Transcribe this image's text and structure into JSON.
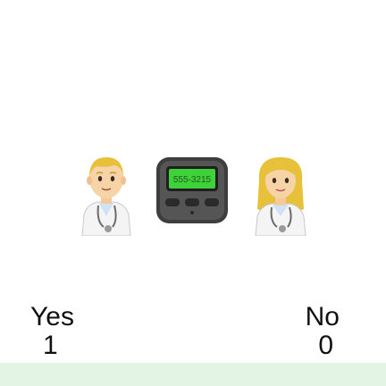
{
  "emojis": {
    "first": "man-health-worker-icon",
    "second": "pager-icon",
    "third": "woman-health-worker-icon",
    "pager_display": "555-3215"
  },
  "choices": {
    "yes_label": "Yes",
    "yes_count": "1",
    "no_label": "No",
    "no_count": "0"
  },
  "colors": {
    "pager_screen": "#3fd13a",
    "pager_body": "#4b4b4b",
    "hair_blonde": "#e8c13a",
    "bottom_bar": "#e3f4e5"
  }
}
